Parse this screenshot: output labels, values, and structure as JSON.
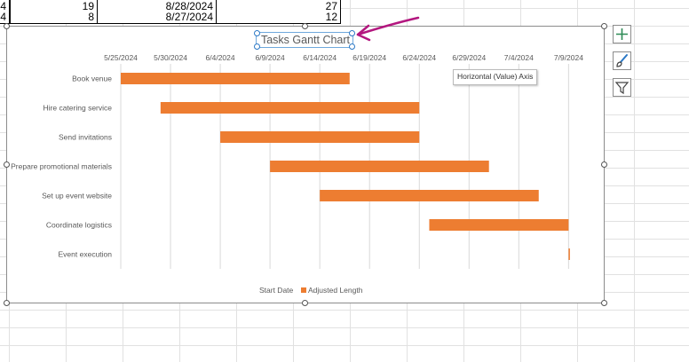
{
  "sheet": {
    "rows": [
      {
        "a": "4",
        "b": "19",
        "c": "8/28/2024",
        "d": "27"
      },
      {
        "a": "4",
        "b": "8",
        "c": "8/27/2024",
        "d": "12"
      }
    ]
  },
  "chart_data": {
    "type": "bar",
    "orientation": "horizontal-stacked",
    "title": "Tasks Gantt Chart",
    "x_ticks": [
      "5/25/2024",
      "5/30/2024",
      "6/4/2024",
      "6/9/2024",
      "6/14/2024",
      "6/19/2024",
      "6/24/2024",
      "6/29/2024",
      "7/4/2024",
      "7/9/2024"
    ],
    "xlim": [
      "5/25/2024",
      "7/12/2024"
    ],
    "tasks": [
      {
        "name": "Book venue",
        "start": "5/25/2024",
        "end": "6/17/2024"
      },
      {
        "name": "Hire catering service",
        "start": "5/29/2024",
        "end": "6/24/2024"
      },
      {
        "name": "Send invitations",
        "start": "6/4/2024",
        "end": "6/24/2024"
      },
      {
        "name": "Prepare promotional materials",
        "start": "6/9/2024",
        "end": "7/1/2024"
      },
      {
        "name": "Set up event website",
        "start": "6/14/2024",
        "end": "7/6/2024"
      },
      {
        "name": "Coordinate logistics",
        "start": "6/25/2024",
        "end": "7/9/2024"
      },
      {
        "name": "Event execution",
        "start": "7/9/2024",
        "end": "7/9/2024"
      }
    ],
    "series": [
      {
        "name": "Start Date",
        "color": "none"
      },
      {
        "name": "Adjusted Length",
        "color": "#ed7d31"
      }
    ],
    "grid": true,
    "legend": "bottom"
  },
  "tooltip": {
    "text": "Horizontal (Value) Axis"
  },
  "side_buttons": [
    {
      "icon": "plus-icon"
    },
    {
      "icon": "brush-icon"
    },
    {
      "icon": "filter-icon"
    }
  ]
}
